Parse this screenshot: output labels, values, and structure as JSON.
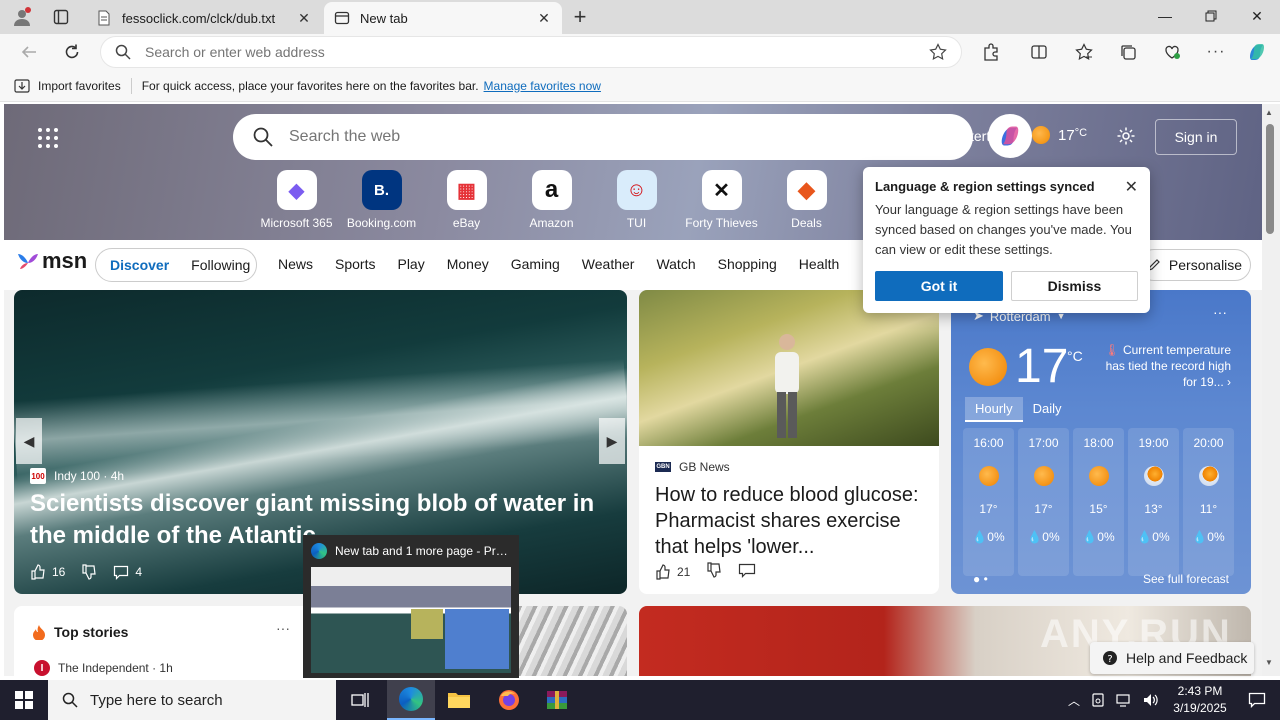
{
  "browser": {
    "tabs": [
      {
        "title": "fessoclick.com/clck/dub.txt",
        "active": false
      },
      {
        "title": "New tab",
        "active": true
      }
    ],
    "address_placeholder": "Search or enter web address",
    "favorites_bar": {
      "import_label": "Import favorites",
      "message": "For quick access, place your favorites here on the favorites bar.",
      "manage_link": "Manage favorites now"
    }
  },
  "newtab": {
    "search_placeholder": "Search the web",
    "overlay_text": "terta",
    "weather_temp": "17",
    "weather_unit": "°C",
    "signin_label": "Sign in",
    "quick_links": [
      {
        "label": "Microsoft 365",
        "glyph": "◆",
        "color": "#7b5cf0"
      },
      {
        "label": "Booking.com",
        "glyph": "B.",
        "color": "#003580"
      },
      {
        "label": "eBay",
        "glyph": "▦",
        "color": "#e53238"
      },
      {
        "label": "Amazon",
        "glyph": "a",
        "color": "#111111"
      },
      {
        "label": "TUI",
        "glyph": "☺",
        "color": "#d40e14"
      },
      {
        "label": "Forty Thieves",
        "glyph": "✕",
        "color": "#111111"
      },
      {
        "label": "Deals",
        "glyph": "◆",
        "color": "#e8561c"
      }
    ]
  },
  "msn": {
    "logo": "msn",
    "discover": "Discover",
    "following": "Following",
    "nav": [
      "News",
      "Sports",
      "Play",
      "Money",
      "Gaming",
      "Weather",
      "Watch",
      "Shopping",
      "Health"
    ],
    "personalise": "Personalise"
  },
  "main_story": {
    "source": "Indy 100 · 4h",
    "source_logo": "100",
    "headline": "Scientists discover giant missing blob of water in the middle of the Atlantic",
    "likes": "16",
    "comments": "4"
  },
  "news_story": {
    "source": "GB News",
    "source_logo": "GBN",
    "headline": "How to reduce blood glucose: Pharmacist shares exercise that helps 'lower...",
    "likes": "21"
  },
  "weather": {
    "location": "Rotterdam",
    "temp": "17",
    "unit": "°C",
    "record_text": "Current temperature has tied the record high for 19...",
    "tabs": [
      "Hourly",
      "Daily"
    ],
    "hours": [
      {
        "time": "16:00",
        "icon": "sun",
        "temp": "17°",
        "precip": "0%"
      },
      {
        "time": "17:00",
        "icon": "sun",
        "temp": "17°",
        "precip": "0%"
      },
      {
        "time": "18:00",
        "icon": "sun",
        "temp": "15°",
        "precip": "0%"
      },
      {
        "time": "19:00",
        "icon": "partly-cloudy",
        "temp": "13°",
        "precip": "0%"
      },
      {
        "time": "20:00",
        "icon": "partly-cloudy",
        "temp": "11°",
        "precip": "0%"
      }
    ],
    "full_forecast": "See full forecast"
  },
  "top_stories": {
    "title": "Top stories",
    "item_source": "The Independent · 1h"
  },
  "popup": {
    "title": "Language & region settings synced",
    "body": "Your language & region settings have been synced based on changes you've made. You can view or edit these settings.",
    "primary": "Got it",
    "secondary": "Dismiss"
  },
  "help_button": "Help and Feedback",
  "watermark": "ANY.RUN",
  "thumbnail_title": "New tab and 1 more page - Pro...",
  "taskbar": {
    "search_placeholder": "Type here to search",
    "time": "2:43 PM",
    "date": "3/19/2025"
  },
  "colors": {
    "accent": "#0f6cbd",
    "taskbar": "#1f1f2e",
    "weather_card": "#5d88d1"
  }
}
